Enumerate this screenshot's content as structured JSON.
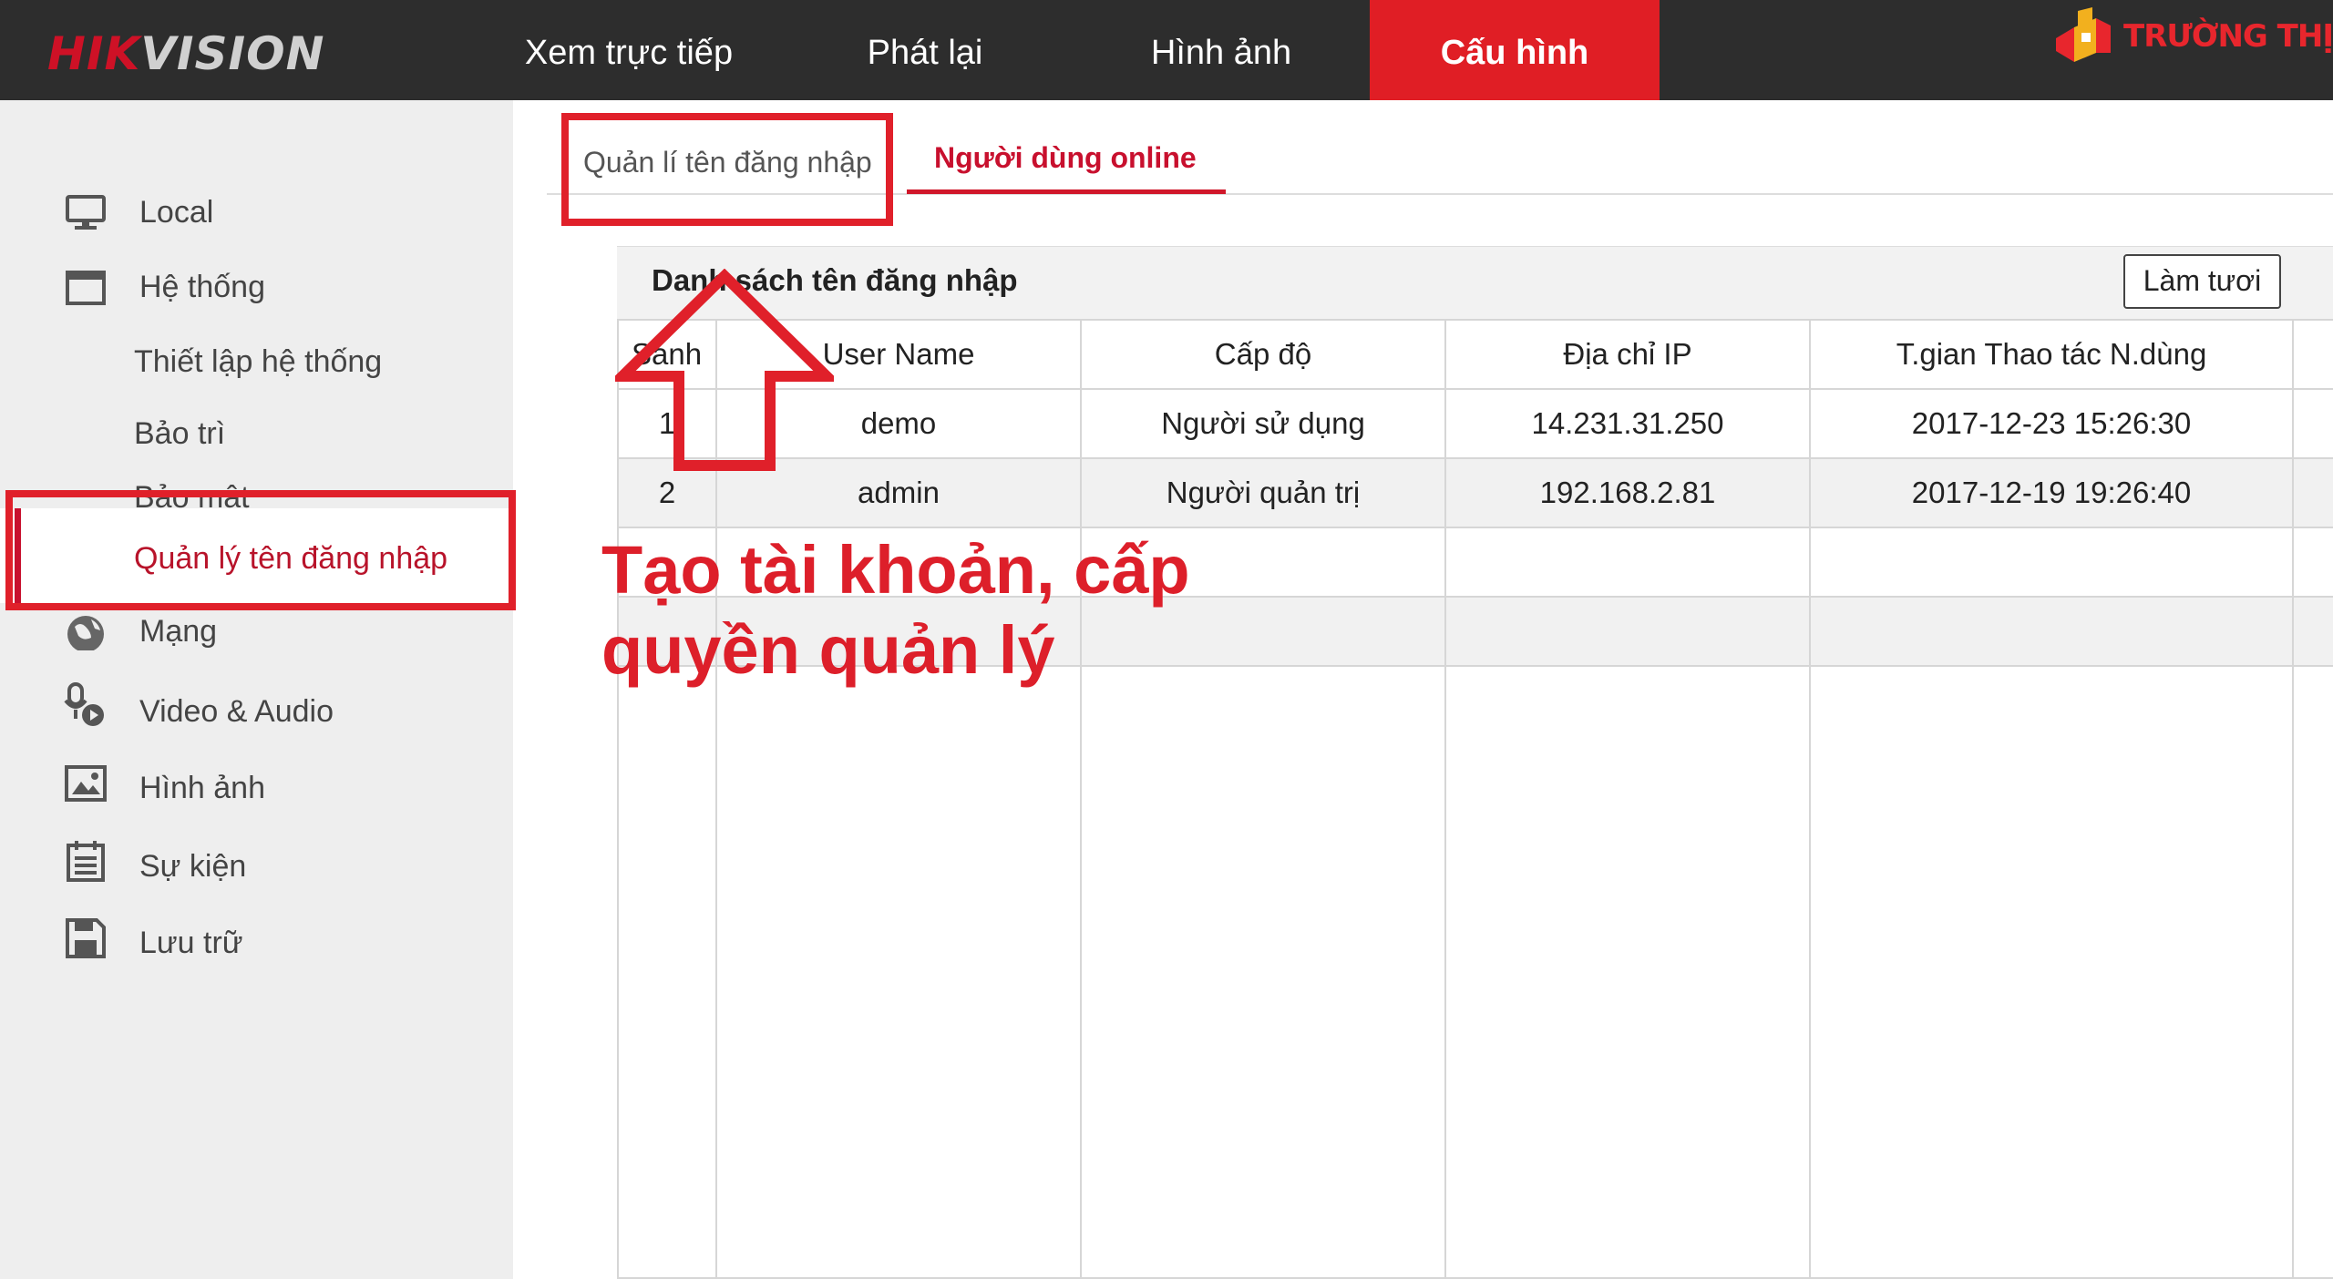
{
  "header": {
    "logo_main": "HIK",
    "logo_rest": "VISION",
    "nav": [
      {
        "label": "Xem trực tiếp"
      },
      {
        "label": "Phát lại"
      },
      {
        "label": "Hình ảnh"
      },
      {
        "label": "Cấu hình"
      }
    ],
    "active_nav": "Cấu hình",
    "brand_text": "TRƯỜNG THỊNH"
  },
  "sidebar": {
    "items": [
      {
        "label": "Local",
        "icon": "monitor-icon"
      },
      {
        "label": "Hệ thống",
        "icon": "window-icon"
      },
      {
        "label": "Thiết lập hệ thống"
      },
      {
        "label": "Bảo trì"
      },
      {
        "label": "Bảo mật"
      },
      {
        "label": "Quản lý tên đăng nhập",
        "active": true
      },
      {
        "label": "Mạng",
        "icon": "globe-icon"
      },
      {
        "label": "Video & Audio",
        "icon": "microphone-camera-icon"
      },
      {
        "label": "Hình ảnh",
        "icon": "image-icon"
      },
      {
        "label": "Sự kiện",
        "icon": "calendar-list-icon"
      },
      {
        "label": "Lưu trữ",
        "icon": "save-disk-icon"
      }
    ]
  },
  "tabs": [
    {
      "label": "Quản lí tên đăng nhập"
    },
    {
      "label": "Người dùng online",
      "active": true
    }
  ],
  "panel": {
    "title": "Danh sách tên đăng nhập",
    "refresh_label": "Làm tươi",
    "columns": [
      "Sanh",
      "User Name",
      "Cấp độ",
      "Địa chỉ IP",
      "T.gian Thao tác N.dùng"
    ],
    "rows": [
      [
        "1",
        "demo",
        "Người sử dụng",
        "14.231.31.250",
        "2017-12-23 15:26:30"
      ],
      [
        "2",
        "admin",
        "Người quản trị",
        "192.168.2.81",
        "2017-12-19 19:26:40"
      ]
    ]
  },
  "annotation": {
    "line1": "Tạo tài khoản, cấp",
    "line2": "quyền quản lý"
  },
  "colors": {
    "accent": "#e01e25",
    "topbar": "#2d2d2d",
    "sidebar": "#eeeeee",
    "annotation": "#dd1f2a"
  }
}
